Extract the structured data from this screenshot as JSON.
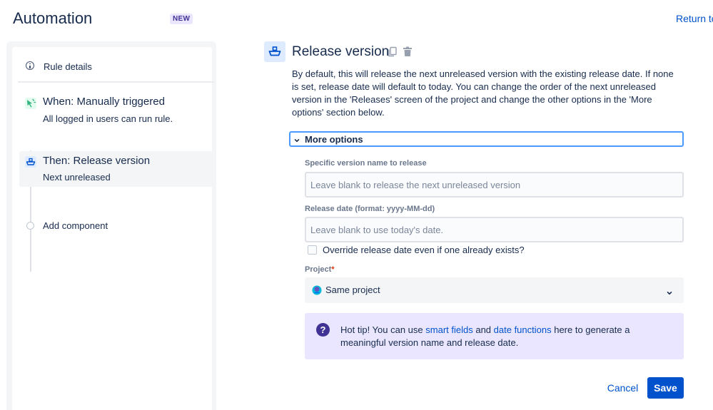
{
  "header": {
    "title": "Automation",
    "badge": "NEW",
    "return_link": "Return to"
  },
  "sidebar": {
    "rule_details": "Rule details",
    "trigger": {
      "title": "When: Manually triggered",
      "subtitle": "All logged in users can run rule.",
      "icon": "cursor-click-icon"
    },
    "action": {
      "title": "Then: Release version",
      "subtitle": "Next unreleased",
      "icon": "ship-icon"
    },
    "add_component": "Add component"
  },
  "editor": {
    "title": "Release version",
    "description": "By default, this will release the next unreleased version with the existing release date. If none is set, release date will default to today. You can change the order of the next unreleased version in the 'Releases' screen of the project and change the other options in the 'More options' section below.",
    "more_options_label": "More options",
    "version_name": {
      "label": "Specific version name to release",
      "placeholder": "Leave blank to release the next unreleased version",
      "value": ""
    },
    "release_date": {
      "label": "Release date (format: yyyy-MM-dd)",
      "placeholder": "Leave blank to use today's date.",
      "value": ""
    },
    "override": {
      "label": "Override release date even if one already exists?",
      "checked": false
    },
    "project": {
      "label": "Project",
      "required_mark": "*",
      "value": "Same project"
    },
    "tip": {
      "prefix": "Hot tip! You can use ",
      "link1": "smart fields",
      "middle": " and ",
      "link2": "date functions",
      "suffix": " here to generate a meaningful version name and release date."
    },
    "buttons": {
      "cancel": "Cancel",
      "save": "Save"
    }
  },
  "colors": {
    "primary": "#0052cc",
    "text": "#172b4d",
    "tip_background": "#eae6ff",
    "tip_icon": "#403294",
    "focus_border": "#4c9aff",
    "trigger_icon": "#36b37e",
    "action_icon": "#0052cc"
  }
}
